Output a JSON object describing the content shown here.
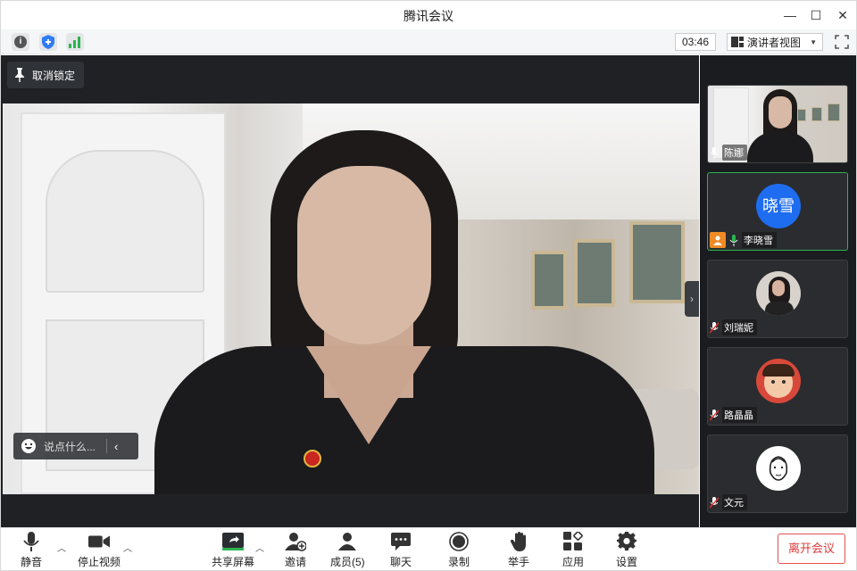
{
  "window": {
    "title": "腾讯会议"
  },
  "toolrow": {
    "timer": "03:46",
    "view_mode": "演讲者视图"
  },
  "stage": {
    "unpin_label": "取消锁定",
    "chat_placeholder": "说点什么..."
  },
  "participants": [
    {
      "name": "陈娜",
      "type": "video",
      "mic": "on"
    },
    {
      "name": "李晓雪",
      "type": "text-avatar",
      "avatar_text": "晓雪",
      "avatar_color": "#1e6cf0",
      "mic": "on",
      "active": true
    },
    {
      "name": "刘瑞妮",
      "type": "photo-avatar",
      "mic": "muted"
    },
    {
      "name": "路晶晶",
      "type": "photo-avatar",
      "mic": "muted"
    },
    {
      "name": "文元",
      "type": "photo-avatar",
      "mic": "muted"
    }
  ],
  "toolbar": {
    "mute": "静音",
    "stop_video": "停止视频",
    "share_screen": "共享屏幕",
    "invite": "邀请",
    "members": "成员(5)",
    "chat": "聊天",
    "record": "录制",
    "raise_hand": "举手",
    "apps": "应用",
    "settings": "设置",
    "leave": "离开会议"
  },
  "colors": {
    "accent_green": "#2cb450",
    "leave_red": "#e03a3a",
    "avatar_blue": "#1e6cf0"
  }
}
